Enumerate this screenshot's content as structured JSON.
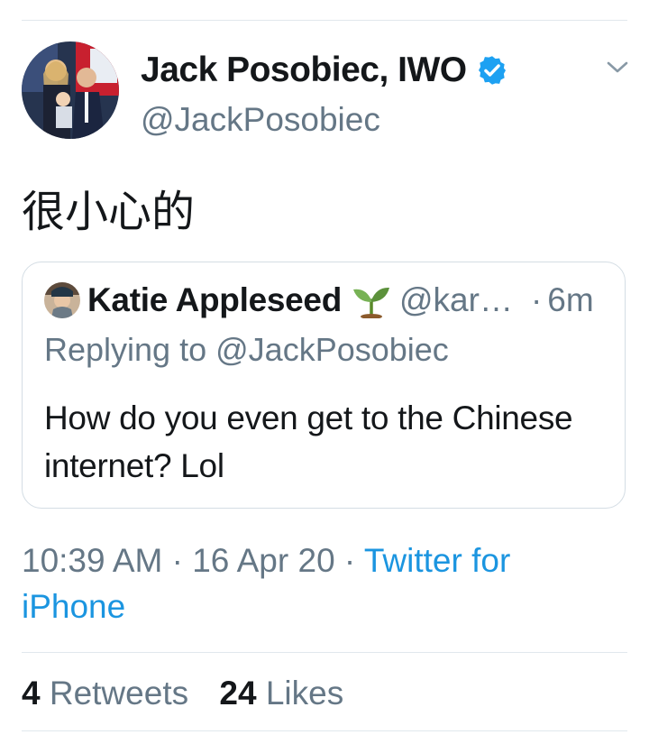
{
  "tweet": {
    "author": {
      "name": "Jack Posobiec, IWO",
      "handle": "@JackPosobiec",
      "verified": true
    },
    "text": "很小心的",
    "quoted": {
      "name": "Katie Appleseed",
      "emoji": "seedling",
      "handle": "@kar…",
      "separator": "·",
      "time": "6m",
      "reply_prefix": "Replying to",
      "reply_to": "@JackPosobiec",
      "text": "How do you even get to the Chinese internet? Lol"
    },
    "meta": {
      "time": "10:39 AM",
      "separator": "·",
      "date": "16 Apr 20",
      "source": "Twitter for iPhone"
    },
    "stats": {
      "retweets": "4",
      "retweets_label": "Retweets",
      "likes": "24",
      "likes_label": "Likes"
    }
  },
  "colors": {
    "text": "#14171a",
    "secondary": "#657786",
    "link": "#1b95e0",
    "verified": "#1da1f2",
    "divider": "#e1e8ed"
  },
  "icons": {
    "verified": "verified-badge-icon",
    "menu": "chevron-down-icon",
    "sprout": "seedling-emoji-icon"
  }
}
